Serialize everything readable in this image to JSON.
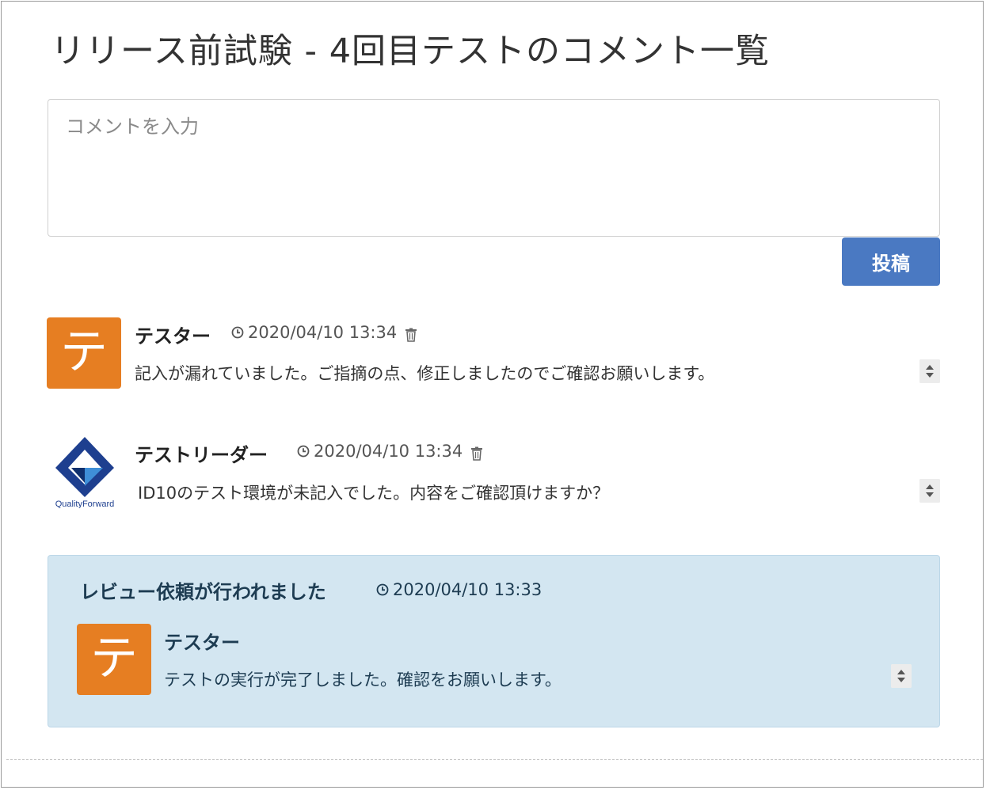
{
  "page": {
    "title": "リリース前試験 - 4回目テストのコメント一覧"
  },
  "comment_form": {
    "placeholder": "コメントを入力",
    "value": "",
    "submit_label": "投稿"
  },
  "comments": [
    {
      "avatar_text": "テ",
      "avatar_color": "#e67e22",
      "author": "テスター",
      "timestamp": "2020/04/10 13:34",
      "body": "記入が漏れていました。ご指摘の点、修正しましたのでご確認お願いします。"
    },
    {
      "avatar_logo": "quality-forward-logo",
      "avatar_logo_text": "QualityForward",
      "author": "テストリーダー",
      "timestamp": "2020/04/10 13:34",
      "body": "ID10のテスト環境が未記入でした。内容をご確認頂けますか？"
    }
  ],
  "review_request": {
    "title": "レビュー依頼が行われました",
    "timestamp": "2020/04/10 13:33",
    "background": "#d3e6f1",
    "comment": {
      "avatar_text": "テ",
      "avatar_color": "#e67e22",
      "author": "テスター",
      "body": "テストの実行が完了しました。確認をお願いします。"
    }
  },
  "icons": {
    "clock": "clock-icon",
    "trash": "trash-icon",
    "spinner": "sort-arrows-icon"
  },
  "colors": {
    "accent_button": "#4a79c2"
  }
}
